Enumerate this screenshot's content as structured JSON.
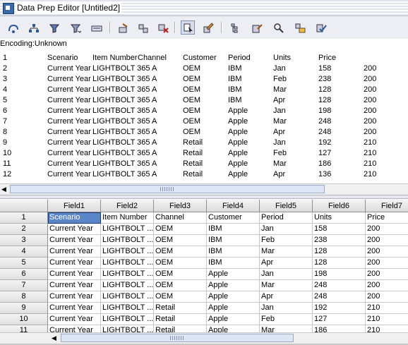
{
  "window": {
    "title": "Data Prep Editor [Untitled2]"
  },
  "toolbar": {
    "buttons": [
      {
        "icon": "record-icon"
      },
      {
        "icon": "hierarchy-icon"
      },
      {
        "icon": "filter-icon"
      },
      {
        "icon": "filter-down-icon"
      },
      {
        "icon": "field-icon"
      },
      {
        "icon": "move-field-icon"
      },
      {
        "icon": "split-field-icon"
      },
      {
        "icon": "delete-field-icon"
      },
      {
        "icon": "select-icon"
      },
      {
        "icon": "edit-icon"
      },
      {
        "icon": "outline-icon"
      },
      {
        "icon": "properties-icon"
      },
      {
        "icon": "search-icon"
      },
      {
        "icon": "dimension-icon"
      },
      {
        "icon": "check-icon"
      }
    ]
  },
  "encoding": "Encoding:Unknown",
  "raw_rows": [
    [
      "1",
      "Scenario",
      "Item Number",
      "Channel",
      "Customer",
      "Period",
      "Units",
      "Price",
      ""
    ],
    [
      "2",
      "Current Year",
      "LIGHTBOLT 365 A",
      "",
      "OEM",
      "IBM",
      "Jan",
      "158",
      "200"
    ],
    [
      "3",
      "Current Year",
      "LIGHTBOLT 365 A",
      "",
      "OEM",
      "IBM",
      "Feb",
      "238",
      "200"
    ],
    [
      "4",
      "Current Year",
      "LIGHTBOLT 365 A",
      "",
      "OEM",
      "IBM",
      "Mar",
      "128",
      "200"
    ],
    [
      "5",
      "Current Year",
      "LIGHTBOLT 365 A",
      "",
      "OEM",
      "IBM",
      "Apr",
      "128",
      "200"
    ],
    [
      "6",
      "Current Year",
      "LIGHTBOLT 365 A",
      "",
      "OEM",
      "Apple",
      "Jan",
      "198",
      "200"
    ],
    [
      "7",
      "Current Year",
      "LIGHTBOLT 365 A",
      "",
      "OEM",
      "Apple",
      "Mar",
      "248",
      "200"
    ],
    [
      "8",
      "Current Year",
      "LIGHTBOLT 365 A",
      "",
      "OEM",
      "Apple",
      "Apr",
      "248",
      "200"
    ],
    [
      "9",
      "Current Year",
      "LIGHTBOLT 365 A",
      "",
      "Retail",
      "Apple",
      "Jan",
      "192",
      "210"
    ],
    [
      "10",
      "Current Year",
      "LIGHTBOLT 365 A",
      "",
      "Retail",
      "Apple",
      "Feb",
      "127",
      "210"
    ],
    [
      "11",
      "Current Year",
      "LIGHTBOLT 365 A",
      "",
      "Retail",
      "Apple",
      "Mar",
      "186",
      "210"
    ],
    [
      "12",
      "Current Year",
      "LIGHTBOLT 365 A",
      "",
      "Retail",
      "Apple",
      "Apr",
      "136",
      "210"
    ]
  ],
  "grid": {
    "headers": [
      "Field1",
      "Field2",
      "Field3",
      "Field4",
      "Field5",
      "Field6",
      "Field7"
    ],
    "rows": [
      {
        "n": "1",
        "cells": [
          "Scenario",
          "Item Number",
          "Channel",
          "Customer",
          "Period",
          "Units",
          "Price"
        ]
      },
      {
        "n": "2",
        "cells": [
          "Current Year",
          "LIGHTBOLT ...",
          "OEM",
          "IBM",
          "Jan",
          "158",
          "200"
        ]
      },
      {
        "n": "3",
        "cells": [
          "Current Year",
          "LIGHTBOLT ...",
          "OEM",
          "IBM",
          "Feb",
          "238",
          "200"
        ]
      },
      {
        "n": "4",
        "cells": [
          "Current Year",
          "LIGHTBOLT ...",
          "OEM",
          "IBM",
          "Mar",
          "128",
          "200"
        ]
      },
      {
        "n": "5",
        "cells": [
          "Current Year",
          "LIGHTBOLT ...",
          "OEM",
          "IBM",
          "Apr",
          "128",
          "200"
        ]
      },
      {
        "n": "6",
        "cells": [
          "Current Year",
          "LIGHTBOLT ...",
          "OEM",
          "Apple",
          "Jan",
          "198",
          "200"
        ]
      },
      {
        "n": "7",
        "cells": [
          "Current Year",
          "LIGHTBOLT ...",
          "OEM",
          "Apple",
          "Mar",
          "248",
          "200"
        ]
      },
      {
        "n": "8",
        "cells": [
          "Current Year",
          "LIGHTBOLT ...",
          "OEM",
          "Apple",
          "Apr",
          "248",
          "200"
        ]
      },
      {
        "n": "9",
        "cells": [
          "Current Year",
          "LIGHTBOLT ...",
          "Retail",
          "Apple",
          "Jan",
          "192",
          "210"
        ]
      },
      {
        "n": "10",
        "cells": [
          "Current Year",
          "LIGHTBOLT ...",
          "Retail",
          "Apple",
          "Feb",
          "127",
          "210"
        ]
      },
      {
        "n": "11",
        "cells": [
          "Current Year",
          "LIGHTBOLT ...",
          "Retail",
          "Apple",
          "Mar",
          "186",
          "210"
        ]
      }
    ],
    "selected": {
      "row": 0,
      "col": 0
    }
  }
}
